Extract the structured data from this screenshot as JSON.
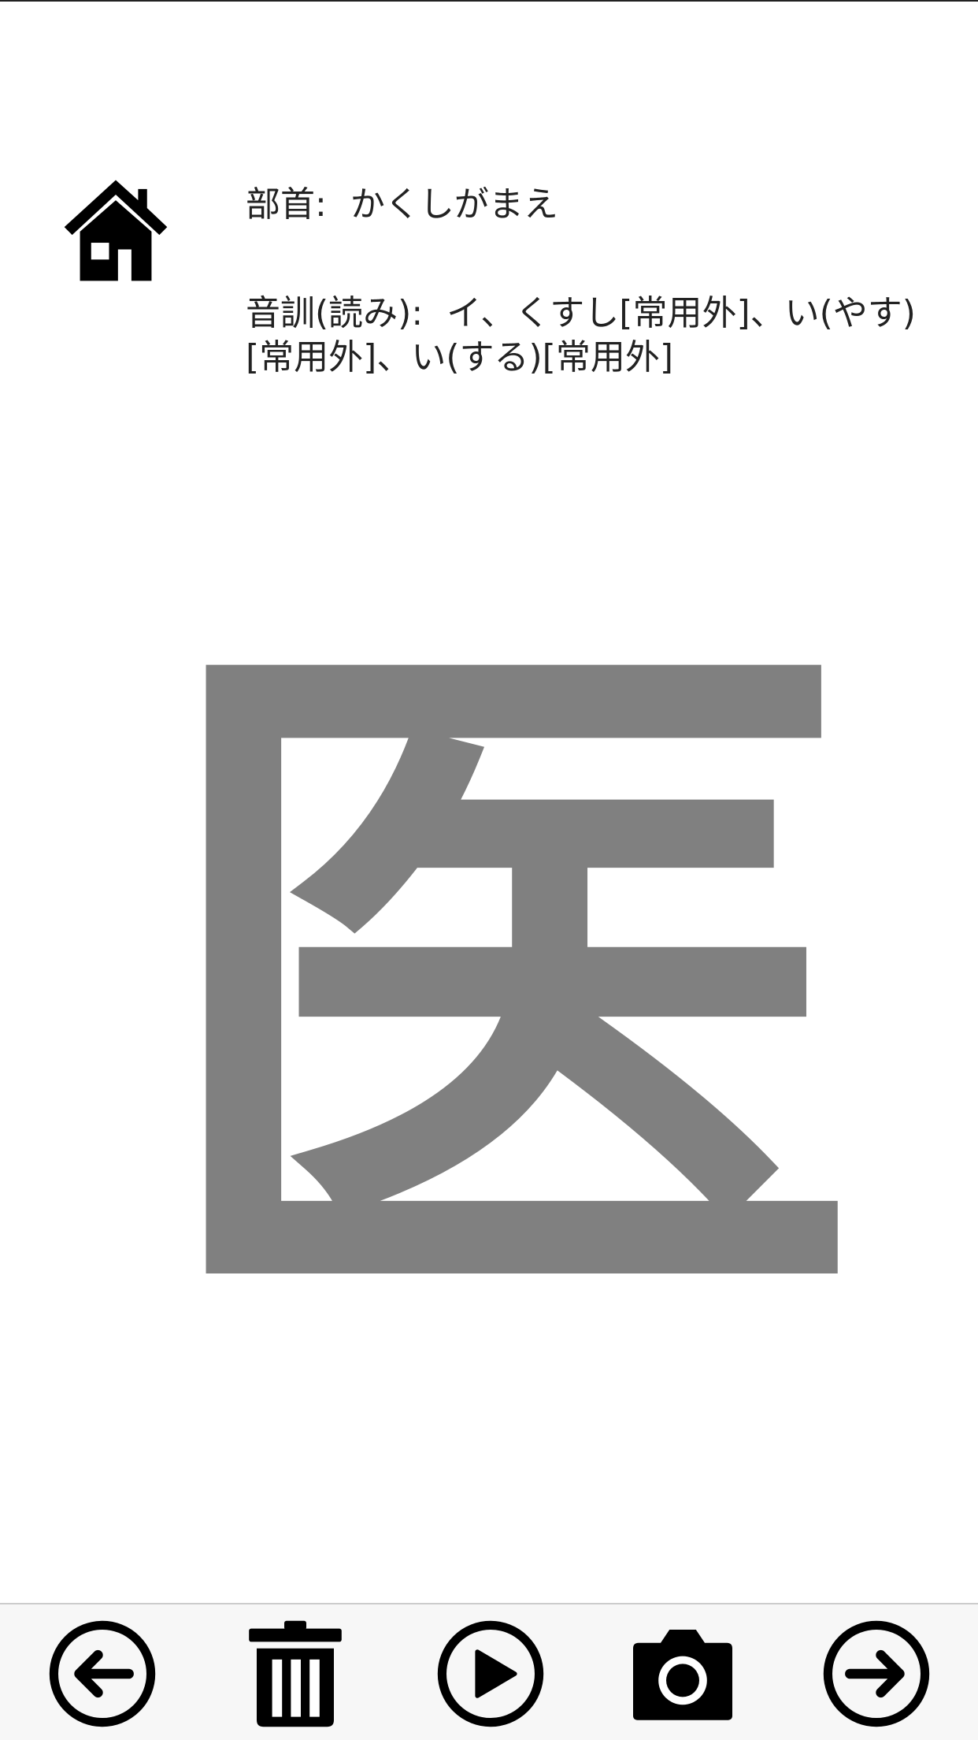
{
  "header": {
    "home_icon": "home-icon"
  },
  "info": {
    "radical_label": "部首:",
    "radical_value": "かくしがまえ",
    "reading_label": "音訓(読み):",
    "reading_value": "イ、くすし[常用外]、い(やす)[常用外]、い(する)[常用外]"
  },
  "kanji": {
    "character": "医",
    "color": "#808080"
  },
  "toolbar": {
    "icons": [
      "arrow-left-circle-icon",
      "trash-icon",
      "play-circle-icon",
      "camera-icon",
      "arrow-right-circle-icon"
    ]
  }
}
